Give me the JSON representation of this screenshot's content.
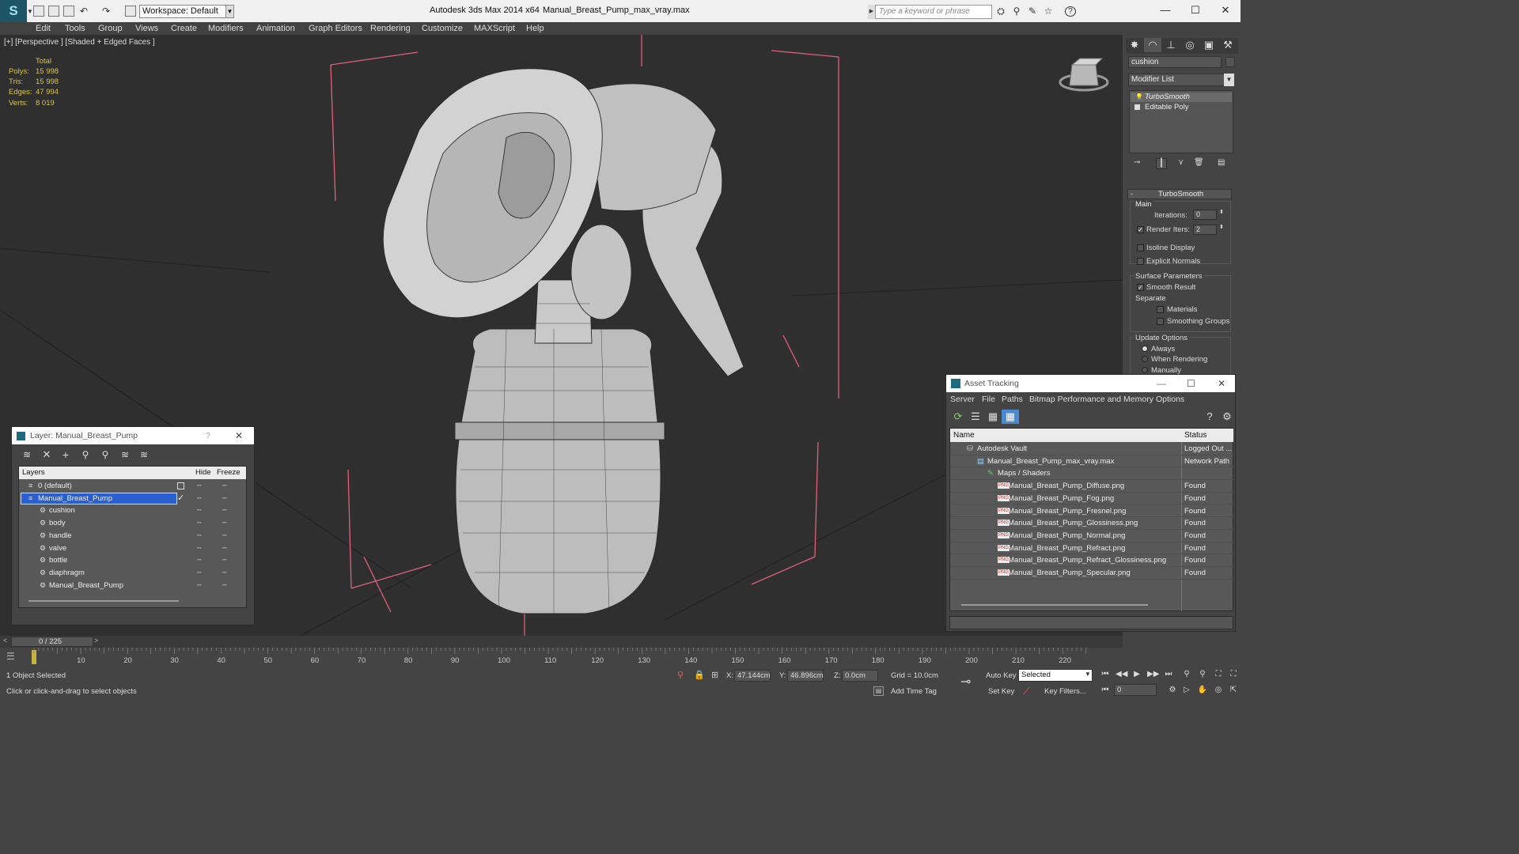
{
  "titlebar": {
    "workspace": "Workspace: Default",
    "app_title": "Autodesk 3ds Max  2014 x64",
    "file_title": "Manual_Breast_Pump_max_vray.max",
    "search_placeholder": "Type a keyword or phrase"
  },
  "menubar": [
    "Edit",
    "Tools",
    "Group",
    "Views",
    "Create",
    "Modifiers",
    "Animation",
    "Graph Editors",
    "Rendering",
    "Customize",
    "MAXScript",
    "Help"
  ],
  "viewport": {
    "label": "[+] [Perspective ] [Shaded + Edged Faces ]",
    "stats": {
      "header": "Total",
      "rows": [
        {
          "label": "Polys:",
          "value": "15 998"
        },
        {
          "label": "Tris:",
          "value": "15 998"
        },
        {
          "label": "Edges:",
          "value": "47 994"
        },
        {
          "label": "Verts:",
          "value": "8 019"
        }
      ]
    }
  },
  "command_panel": {
    "object_name": "cushion",
    "modifier_list": "Modifier List",
    "stack": [
      "TurboSmooth",
      "Editable Poly"
    ],
    "rollout_title": "TurboSmooth",
    "main_label": "Main",
    "iterations_label": "Iterations:",
    "iterations_value": "0",
    "render_iters_label": "Render Iters:",
    "render_iters_value": "2",
    "isoline": "Isoline Display",
    "explicit_normals": "Explicit Normals",
    "surface_params": "Surface Parameters",
    "smooth_result": "Smooth Result",
    "separate": "Separate",
    "materials": "Materials",
    "smoothing_groups": "Smoothing Groups",
    "update_options": "Update Options",
    "always": "Always",
    "when_rendering": "When Rendering",
    "manually": "Manually"
  },
  "layers_window": {
    "title": "Layer: Manual_Breast_Pump",
    "help": "?",
    "columns": [
      "Layers",
      "Hide",
      "Freeze"
    ],
    "rows": [
      {
        "name": "0 (default)",
        "indent": 1,
        "selected": false,
        "icon": "layer-icon"
      },
      {
        "name": "Manual_Breast_Pump",
        "indent": 1,
        "selected": true,
        "icon": "layer-icon"
      },
      {
        "name": "cushion",
        "indent": 2,
        "selected": false,
        "icon": "object-icon"
      },
      {
        "name": "body",
        "indent": 2,
        "selected": false,
        "icon": "object-icon"
      },
      {
        "name": "handle",
        "indent": 2,
        "selected": false,
        "icon": "object-icon"
      },
      {
        "name": "valve",
        "indent": 2,
        "selected": false,
        "icon": "object-icon"
      },
      {
        "name": "bottle",
        "indent": 2,
        "selected": false,
        "icon": "object-icon"
      },
      {
        "name": "diaphragm",
        "indent": 2,
        "selected": false,
        "icon": "object-icon"
      },
      {
        "name": "Manual_Breast_Pump",
        "indent": 2,
        "selected": false,
        "icon": "object-icon"
      }
    ]
  },
  "asset_window": {
    "title": "Asset Tracking",
    "menu": [
      "Server",
      "File",
      "Paths",
      "Bitmap Performance and Memory",
      "Options"
    ],
    "columns": [
      "Name",
      "Status"
    ],
    "rows": [
      {
        "name": "Autodesk Vault",
        "status": "Logged Out ...",
        "indent": 1,
        "icon": "vault-icon"
      },
      {
        "name": "Manual_Breast_Pump_max_vray.max",
        "status": "Network Path",
        "indent": 2,
        "icon": "max-file-icon"
      },
      {
        "name": "Maps / Shaders",
        "status": "",
        "indent": 3,
        "icon": "maps-icon"
      },
      {
        "name": "Manual_Breast_Pump_Diffuse.png",
        "status": "Found",
        "indent": 4,
        "icon": "png-icon"
      },
      {
        "name": "Manual_Breast_Pump_Fog.png",
        "status": "Found",
        "indent": 4,
        "icon": "png-icon"
      },
      {
        "name": "Manual_Breast_Pump_Fresnel.png",
        "status": "Found",
        "indent": 4,
        "icon": "png-icon"
      },
      {
        "name": "Manual_Breast_Pump_Glossiness.png",
        "status": "Found",
        "indent": 4,
        "icon": "png-icon"
      },
      {
        "name": "Manual_Breast_Pump_Normal.png",
        "status": "Found",
        "indent": 4,
        "icon": "png-icon"
      },
      {
        "name": "Manual_Breast_Pump_Refract.png",
        "status": "Found",
        "indent": 4,
        "icon": "png-icon"
      },
      {
        "name": "Manual_Breast_Pump_Refract_Glossiness.png",
        "status": "Found",
        "indent": 4,
        "icon": "png-icon"
      },
      {
        "name": "Manual_Breast_Pump_Specular.png",
        "status": "Found",
        "indent": 4,
        "icon": "png-icon"
      }
    ]
  },
  "timeline": {
    "frame": "0 / 225",
    "ticks": [
      "10",
      "20",
      "30",
      "40",
      "50",
      "60",
      "70",
      "80",
      "90",
      "100",
      "110",
      "120",
      "130",
      "140",
      "150",
      "160",
      "170",
      "180",
      "190",
      "200",
      "210",
      "220"
    ]
  },
  "status": {
    "selected": "1 Object Selected",
    "prompt": "Click or click-and-drag to select objects",
    "x_label": "X:",
    "x_value": "47.144cm",
    "y_label": "Y:",
    "y_value": "46.896cm",
    "z_label": "Z:",
    "z_value": "0.0cm",
    "grid": "Grid = 10.0cm",
    "add_time_tag": "Add Time Tag",
    "auto_key": "Auto Key",
    "set_key": "Set Key",
    "selected_dropdown": "Selected",
    "key_filters": "Key Filters...",
    "frame_field": "0"
  },
  "colors": {
    "selection": "#2a5fd0",
    "stat_text": "#d9c44f",
    "bbox": "#e0607a"
  }
}
